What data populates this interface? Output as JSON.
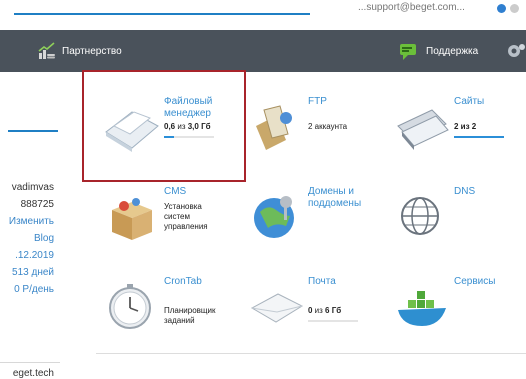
{
  "topbar": {
    "email": "...support@beget.com...",
    "dot_colors": [
      "#2f7fd0",
      "#cccccc"
    ]
  },
  "nav": {
    "partners_label": "Партнерство",
    "support_label": "Поддержка"
  },
  "sidebar": {
    "lines": [
      {
        "text": "vadimvas",
        "link": false
      },
      {
        "text": "888725",
        "link": false
      },
      {
        "text": "Изменить",
        "link": true
      },
      {
        "text": "Blog",
        "link": true
      },
      {
        "text": ".12.2019",
        "link": true
      },
      {
        "text": "513 дней",
        "link": true
      },
      {
        "text": "0 Р/день",
        "link": true
      }
    ],
    "footer_text": "eget.tech"
  },
  "tiles": {
    "file_manager": {
      "title": "Файловый менеджер",
      "sub_bold": "0,6",
      "sub_mid": " из ",
      "sub_bold2": "3,0 Гб",
      "usage_fraction": 0.2
    },
    "ftp": {
      "title": "FTP",
      "sub": "2 аккаунта"
    },
    "sites": {
      "title": "Сайты",
      "sub": "2 из 2",
      "usage_fraction": 1.0
    },
    "cms": {
      "title": "CMS",
      "sub": "Установка систем управления"
    },
    "domains": {
      "title": "Домены и поддомены"
    },
    "dns": {
      "title": "DNS"
    },
    "crontab": {
      "title": "CronTab",
      "sub": "Планировщик заданий"
    },
    "mail": {
      "title": "Почта",
      "sub_bold": "0",
      "sub_mid": " из ",
      "sub_bold2": "6 Гб"
    },
    "services": {
      "title": "Сервисы"
    }
  },
  "colors": {
    "accent": "#1f7fc4",
    "nav_bg": "#4a525b",
    "highlight": "#a8242b",
    "tile_title": "#3a8fd0"
  }
}
